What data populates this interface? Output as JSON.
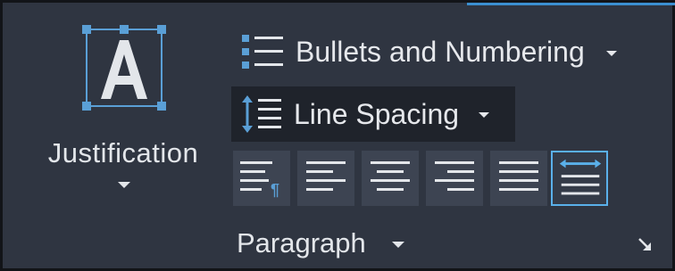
{
  "justification": {
    "label": "Justification"
  },
  "bullets": {
    "label": "Bullets and Numbering"
  },
  "line_spacing": {
    "label": "Line Spacing"
  },
  "alignment_buttons": [
    {
      "name": "default-icon",
      "active": false
    },
    {
      "name": "align-left-icon",
      "active": false
    },
    {
      "name": "align-center-icon",
      "active": false
    },
    {
      "name": "align-right-icon",
      "active": false
    },
    {
      "name": "justify-icon",
      "active": false
    },
    {
      "name": "distribute-icon",
      "active": true
    }
  ],
  "panel": {
    "title": "Paragraph"
  },
  "colors": {
    "accent": "#5ab0ea",
    "panel_bg": "#2f3541",
    "text": "#e6e8ec"
  }
}
